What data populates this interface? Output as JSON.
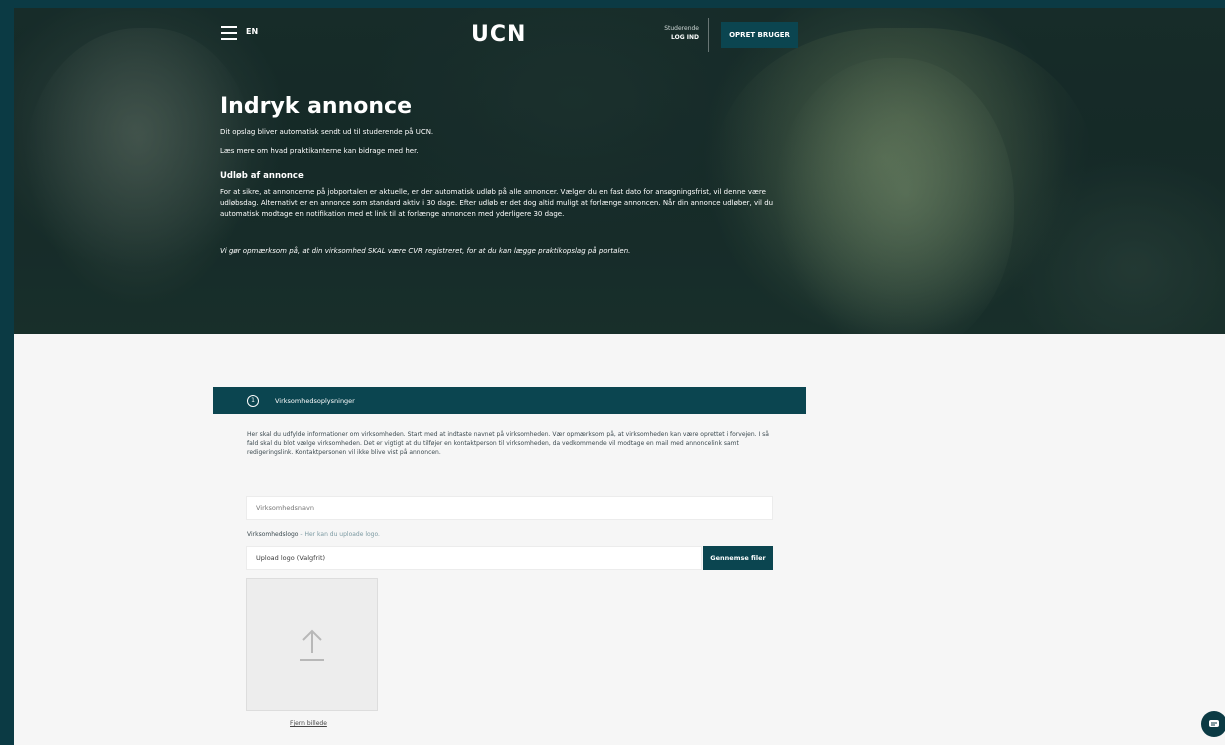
{
  "header": {
    "lang": "EN",
    "logo": "UCN",
    "login_label": "Studerende",
    "login_action": "LOG IND",
    "signup_button": "OPRET BRUGER"
  },
  "hero": {
    "title": "Indryk annonce",
    "line1": "Dit opslag bliver automatisk sendt ud til studerende på UCN.",
    "line2": "Læs mere om hvad praktikanterne kan bidrage med her.",
    "subtitle": "Udløb af annonce",
    "body": "For at sikre, at annoncerne på jobportalen er aktuelle, er der automatisk udløb på alle annoncer. Vælger du en fast dato for ansøgningsfrist, vil denne være udløbsdag. Alternativt er en annonce som standard aktiv i 30 dage. Efter udløb er det dog altid muligt at forlænge annoncen. Når din annonce udløber, vil du automatisk modtage en notifikation med et link til at forlænge annoncen med yderligere 30 dage.",
    "note": "Vi gør opmærksom på, at din virksomhed SKAL være CVR registreret, for at du kan lægge praktikopslag på portalen."
  },
  "step": {
    "number": "1",
    "label": "Virksomhedsoplysninger",
    "intro": "Her skal du udfylde informationer om virksomheden. Start med at indtaste navnet på virksomheden. Vær opmærksom på, at virksomheden kan være oprettet i forvejen. I så fald skal du blot vælge virksomheden. Det er vigtigt at du tilføjer en kontaktperson til virksomheden, da vedkommende vil modtage en mail med annoncelink samt redigeringslink. Kontaktpersonen vil ikke blive vist på annoncen."
  },
  "form": {
    "company_placeholder": "Virksomhedsnavn",
    "logo_label": "Virksomhedslogo",
    "logo_hint": " - Her kan du uploade logo.",
    "upload_placeholder": "Upload logo (Valgfrit)",
    "browse_button": "Gennemse filer",
    "remove_image": "Fjern billede"
  },
  "icons": {
    "menu": "hamburger-icon",
    "upload": "upload-arrow-icon",
    "chat": "chat-icon"
  },
  "colors": {
    "brand": "#0b4550",
    "frame": "#0b3a44"
  }
}
